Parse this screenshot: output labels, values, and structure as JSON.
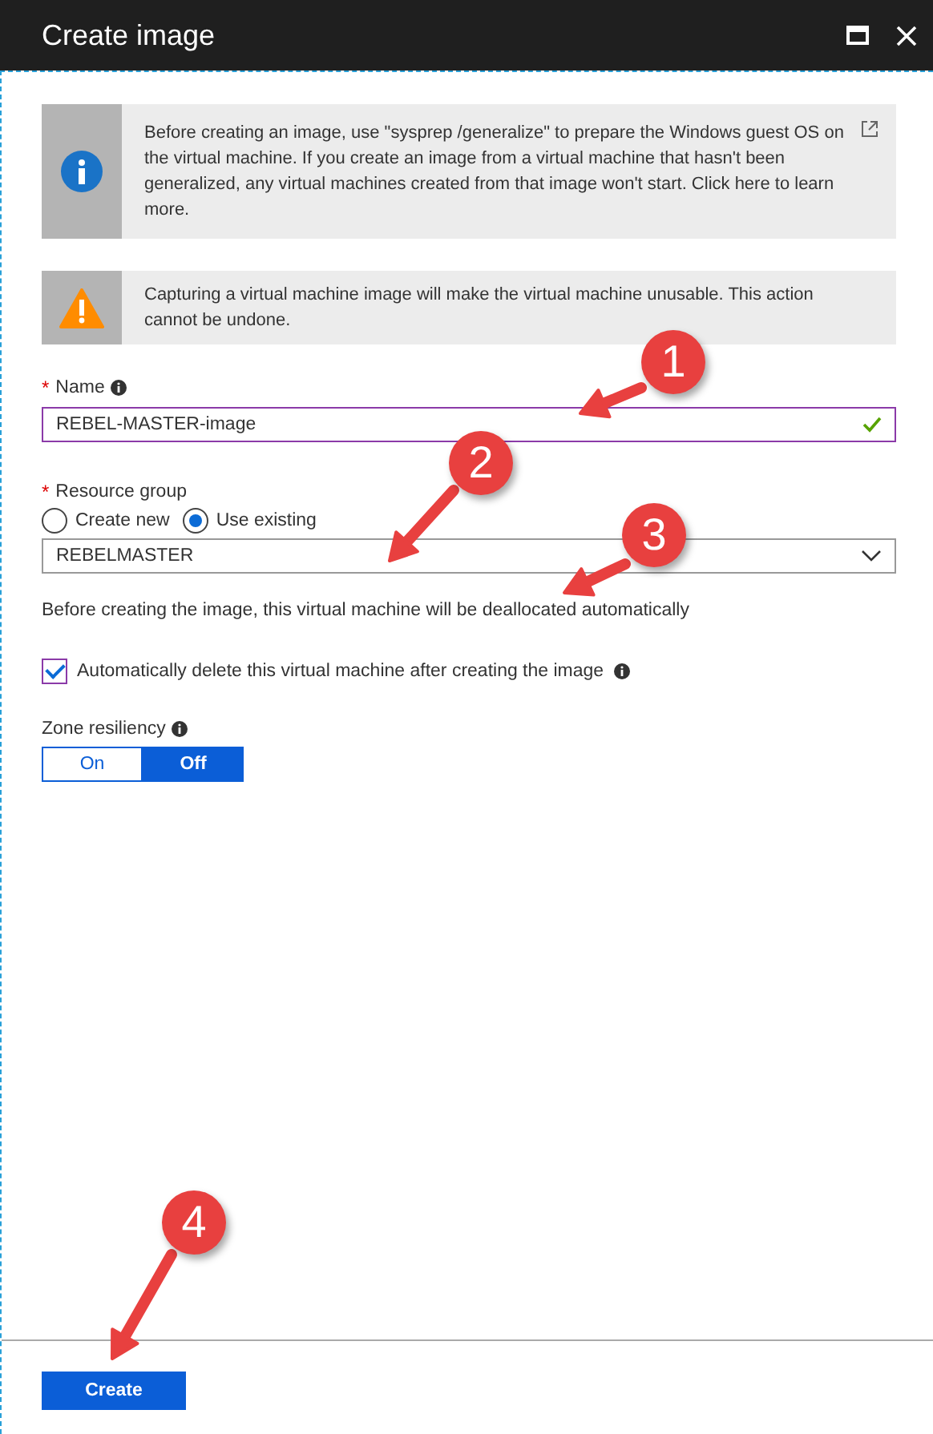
{
  "window": {
    "title": "Create image"
  },
  "notices": [
    {
      "kind": "info",
      "text": "Before creating an image, use \"sysprep /generalize\" to prepare the Windows guest OS on the virtual machine. If you create an image from a virtual machine that hasn't been generalized, any virtual machines created from that image won't start. Click here to learn more.",
      "external_link": true
    },
    {
      "kind": "warning",
      "text": "Capturing a virtual machine image will make the virtual machine unusable. This action cannot be undone.",
      "external_link": false
    }
  ],
  "name_field": {
    "label": "Name",
    "required_mark": "*",
    "value": "REBEL-MASTER-image",
    "valid": true
  },
  "resource_group": {
    "label": "Resource group",
    "required_mark": "*",
    "options": [
      {
        "label": "Create new",
        "selected": false
      },
      {
        "label": "Use existing",
        "selected": true
      }
    ],
    "value": "REBELMASTER"
  },
  "note": "Before creating the image, this virtual machine will be deallocated automatically",
  "auto_delete": {
    "label": "Automatically delete this virtual machine after creating the image",
    "checked": true
  },
  "zone_resiliency": {
    "label": "Zone resiliency",
    "options": [
      {
        "label": "On",
        "selected": false
      },
      {
        "label": "Off",
        "selected": true
      }
    ]
  },
  "create_button": "Create",
  "callouts": [
    {
      "label": "1"
    },
    {
      "label": "2"
    },
    {
      "label": "3"
    },
    {
      "label": "4"
    }
  ]
}
